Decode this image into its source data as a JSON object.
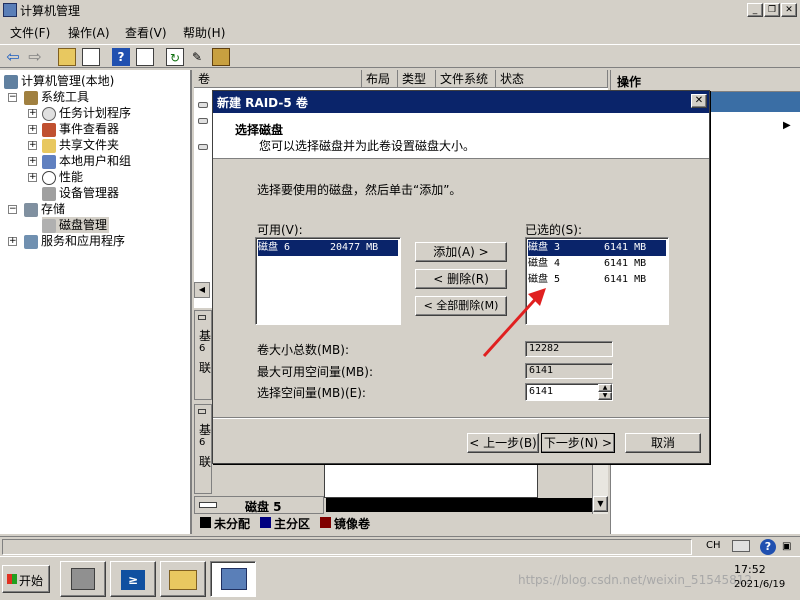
{
  "window": {
    "title": "计算机管理"
  },
  "menu": [
    "文件(F)",
    "操作(A)",
    "查看(V)",
    "帮助(H)"
  ],
  "tree": {
    "root": "计算机管理(本地)",
    "system_tools": "系统工具",
    "task_scheduler": "任务计划程序",
    "event_viewer": "事件查看器",
    "shared_folders": "共享文件夹",
    "local_users": "本地用户和组",
    "performance": "性能",
    "device_manager": "设备管理器",
    "storage": "存储",
    "disk_management": "磁盘管理",
    "services_apps": "服务和应用程序"
  },
  "center": {
    "columns": [
      "卷",
      "布局",
      "类型",
      "文件系统",
      "状态"
    ],
    "lower_labels": [
      "基",
      "6",
      "联",
      "基",
      "6",
      "联"
    ],
    "disk5_label": "磁盘 5"
  },
  "legend": {
    "unallocated": "未分配",
    "primary": "主分区",
    "mirror": "镜像卷",
    "colors": {
      "unallocated": "#000000",
      "primary": "#000080",
      "mirror": "#800000"
    }
  },
  "actions": {
    "header": "操作"
  },
  "dialog": {
    "title": "新建 RAID-5 卷",
    "heading": "选择磁盘",
    "subheading": "您可以选择磁盘并为此卷设置磁盘大小。",
    "instruction": "选择要使用的磁盘，然后单击“添加”。",
    "available_label": "可用(V):",
    "available": [
      {
        "name": "磁盘 6",
        "size": "20477 MB"
      }
    ],
    "selected_label": "已选的(S):",
    "selected": [
      {
        "name": "磁盘 3",
        "size": "6141 MB"
      },
      {
        "name": "磁盘 4",
        "size": "6141 MB"
      },
      {
        "name": "磁盘 5",
        "size": "6141 MB"
      }
    ],
    "add_button": "添加(A) >",
    "remove_button": "< 删除(R)",
    "remove_all_button": "< 全部删除(M)",
    "total_size_label": "卷大小总数(MB):",
    "total_size": "12282",
    "max_space_label": "最大可用空间量(MB):",
    "max_space": "6141",
    "select_space_label": "选择空间量(MB)(E):",
    "select_space": "6141",
    "back_button": "< 上一步(B)",
    "next_button": "下一步(N) >",
    "cancel_button": "取消"
  },
  "annotation": {
    "arrow_color": "#e02020"
  },
  "taskbar": {
    "start": "开始",
    "ime": "CH",
    "time": "17:52",
    "date": "2021/6/19",
    "watermark": "https://blog.csdn.net/weixin_51545812"
  }
}
